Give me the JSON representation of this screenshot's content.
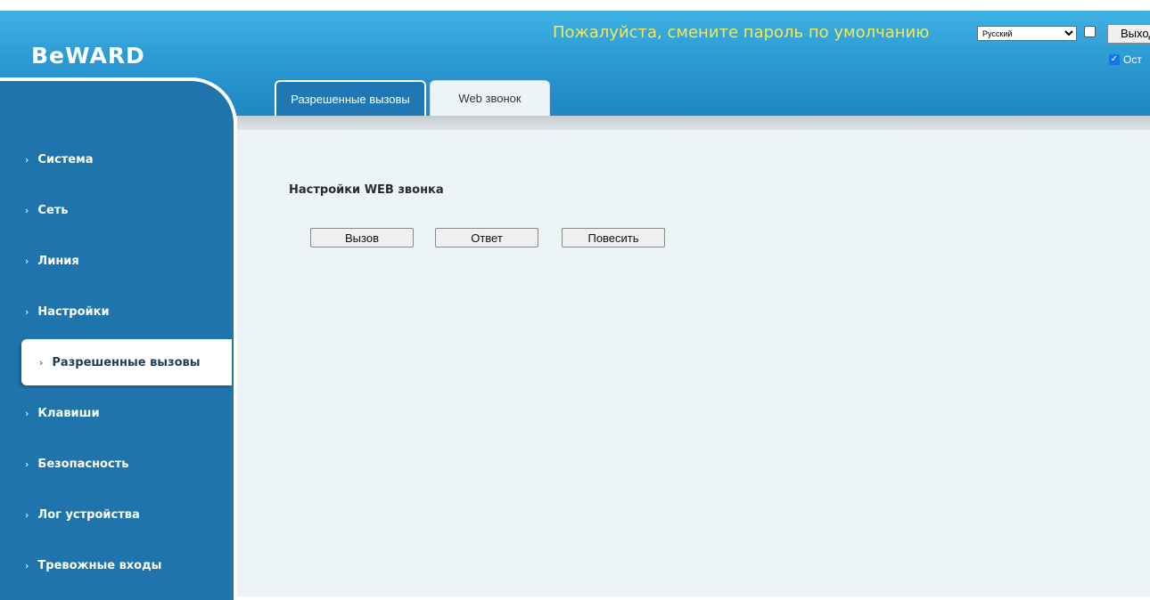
{
  "header": {
    "logo": "BeWARD",
    "warning": "Пожалуйста, смените пароль по умолчанию",
    "language_select": {
      "value": "Русский"
    },
    "logout_label": "Выход",
    "keep_label": "Ост"
  },
  "tabs": [
    {
      "label": "Разрешенные вызовы",
      "active": true
    },
    {
      "label": "Web звонок",
      "active": false
    }
  ],
  "sidebar": {
    "items": [
      {
        "label": "Система"
      },
      {
        "label": "Сеть"
      },
      {
        "label": "Линия"
      },
      {
        "label": "Настройки"
      },
      {
        "label": "Разрешенные вызовы",
        "active": true
      },
      {
        "label": "Клавиши"
      },
      {
        "label": "Безопасность"
      },
      {
        "label": "Лог устройства"
      },
      {
        "label": "Тревожные входы"
      }
    ]
  },
  "main": {
    "section_title": "Настройки WEB звонка",
    "buttons": {
      "call": "Вызов",
      "answer": "Ответ",
      "hangup": "Повесить"
    }
  },
  "colors": {
    "header_blue": "#2c9ad3",
    "sidebar_blue": "#1f75ab",
    "warning_yellow": "#f2ea56",
    "content_bg": "#ecf4f7"
  }
}
